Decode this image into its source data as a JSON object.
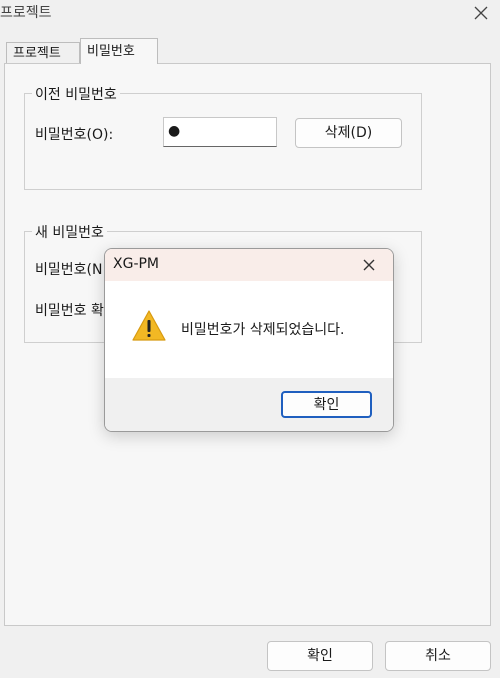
{
  "window": {
    "title": "프로젝트"
  },
  "tabs": [
    {
      "label": "프로젝트"
    },
    {
      "label": "비밀번호"
    }
  ],
  "old_password": {
    "legend": "이전 비밀번호",
    "label": "비밀번호(O):",
    "masked_value": "●",
    "delete_label": "삭제(D)"
  },
  "new_password": {
    "legend": "새 비밀번호",
    "label1": "비밀번호(N",
    "label2": "비밀번호 확"
  },
  "footer": {
    "ok_label": "확인",
    "cancel_label": "취소"
  },
  "message_box": {
    "title": "XG-PM",
    "message": "비밀번호가 삭제되었습니다.",
    "ok_label": "확인",
    "icon": "warning-icon"
  },
  "colors": {
    "warning": "#f2b824",
    "focus_border": "#1f5fbf",
    "msg_titlebar": "#f9ede9"
  }
}
